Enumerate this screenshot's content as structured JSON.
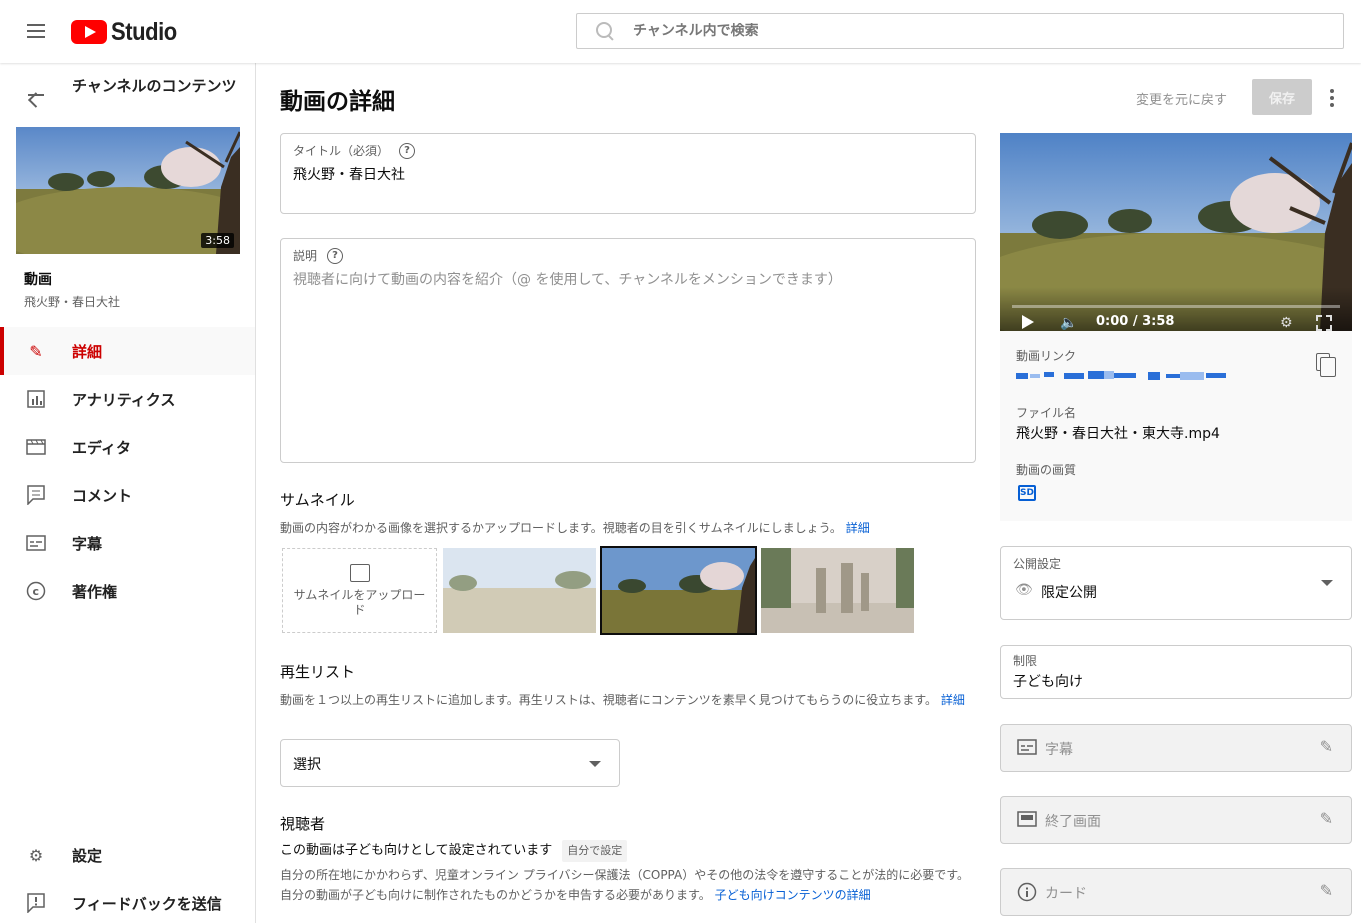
{
  "header": {
    "logo_text": "Studio",
    "search_placeholder": "チャンネル内で検索"
  },
  "sidebar": {
    "back_title": "チャンネルのコンテンツ",
    "thumb_duration": "3:58",
    "video_label": "動画",
    "video_name": "飛火野・春日大社",
    "items": [
      {
        "label": "詳細",
        "icon": "pencil-icon",
        "active": true
      },
      {
        "label": "アナリティクス",
        "icon": "analytics-icon",
        "active": false
      },
      {
        "label": "エディタ",
        "icon": "editor-icon",
        "active": false
      },
      {
        "label": "コメント",
        "icon": "comment-icon",
        "active": false
      },
      {
        "label": "字幕",
        "icon": "subtitles-icon",
        "active": false
      },
      {
        "label": "著作権",
        "icon": "copyright-icon",
        "active": false
      }
    ],
    "bottom_items": [
      {
        "label": "設定",
        "icon": "gear-icon"
      },
      {
        "label": "フィードバックを送信",
        "icon": "feedback-icon"
      }
    ]
  },
  "main": {
    "page_title": "動画の詳細",
    "undo_label": "変更を元に戻す",
    "save_label": "保存",
    "title_field": {
      "label": "タイトル（必須）",
      "value": "飛火野・春日大社"
    },
    "description_field": {
      "label": "説明",
      "placeholder": "視聴者に向けて動画の内容を紹介（@ を使用して、チャンネルをメンションできます）"
    },
    "thumbnail": {
      "title": "サムネイル",
      "desc": "動画の内容がわかる画像を選択するかアップロードします。視聴者の目を引くサムネイルにしましょう。",
      "link": "詳細",
      "upload_label": "サムネイルをアップロード"
    },
    "playlist": {
      "title": "再生リスト",
      "desc": "動画を１つ以上の再生リストに追加します。再生リストは、視聴者にコンテンツを素早く見つけてもらうのに役立ちます。",
      "link": "詳細",
      "select_value": "選択"
    },
    "audience": {
      "title": "視聴者",
      "status": "この動画は子ども向けとして設定されています",
      "badge": "自分で設定",
      "desc": "自分の所在地にかかわらず、児童オンライン プライバシー保護法（COPPA）やその他の法令を遵守することが法的に必要です。自分の動画が子ども向けに制作されたものかどうかを申告する必要があります。",
      "link": "子ども向けコンテンツの詳細"
    }
  },
  "right": {
    "time": "0:00 / 3:58",
    "link_label": "動画リンク",
    "file_label": "ファイル名",
    "file_name": "飛火野・春日大社・東大寺.mp4",
    "quality_label": "動画の画質",
    "quality_badge": "SD",
    "visibility": {
      "label": "公開設定",
      "value": "限定公開"
    },
    "restriction": {
      "label": "制限",
      "value": "子ども向け"
    },
    "subtitles": "字幕",
    "end_screen": "終了画面",
    "cards": "カード"
  },
  "colors": {
    "accent": "#cc0000",
    "link": "#065fd4",
    "brand": "#ff0000"
  }
}
